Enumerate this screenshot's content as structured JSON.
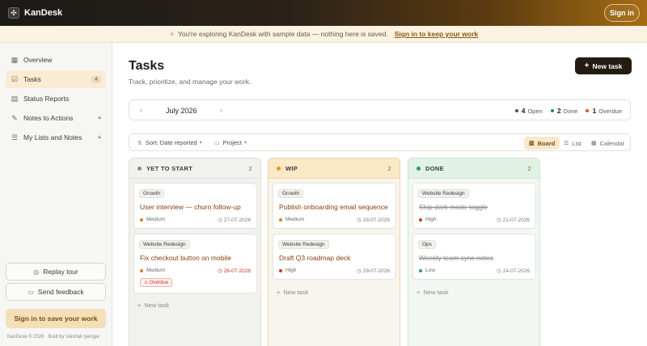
{
  "app": {
    "name": "KanDesk",
    "signin_label": "Sign in"
  },
  "banner": {
    "text": "You're exploring KanDesk with sample data — nothing here is saved.",
    "link": "Sign in to keep your work"
  },
  "sidebar": {
    "items": [
      {
        "label": "Overview",
        "icon": "grid-icon"
      },
      {
        "label": "Tasks",
        "icon": "checkbox-icon",
        "count": "4",
        "active": true
      },
      {
        "label": "Status Reports",
        "icon": "document-icon"
      },
      {
        "label": "Notes to Actions",
        "icon": "file-edit-icon",
        "locked": true
      },
      {
        "label": "My Lists and Notes",
        "icon": "list-icon",
        "locked": true
      }
    ],
    "replay_tour": "Replay tour",
    "send_feedback": "Send feedback",
    "cta": "Sign in to save your work",
    "footer": "KanDesk © 2026 · Built by Vaishali Iyengar"
  },
  "page": {
    "title": "Tasks",
    "subtitle": "Track, prioritize, and manage your work.",
    "new_task_label": "New task"
  },
  "month": {
    "label": "July 2026",
    "stats": [
      {
        "count": "4",
        "label": "Open",
        "color": "#555555"
      },
      {
        "count": "2",
        "label": "Done",
        "color": "#2e8a55"
      },
      {
        "count": "1",
        "label": "Overdue",
        "color": "#d9542c"
      }
    ]
  },
  "toolbar": {
    "sort_label": "Sort: Date reported",
    "project_label": "Project",
    "views": [
      "Board",
      "List",
      "Calendar"
    ],
    "active_view": "Board"
  },
  "columns": [
    {
      "title": "YET TO START",
      "count": "2",
      "color": "#8a8a8a",
      "cards": [
        {
          "tag": "Growth",
          "title": "User interview — churn follow-up",
          "priority": "Medium",
          "priority_color": "#d9822c",
          "due": "27-07-2026"
        },
        {
          "tag": "Website Redesign",
          "title": "Fix checkout button on mobile",
          "priority": "Medium",
          "priority_color": "#d9822c",
          "due": "26-07-2026",
          "overdue": "Overdue"
        }
      ],
      "new_task": "New task"
    },
    {
      "title": "WIP",
      "count": "2",
      "color": "#d99a2c",
      "cards": [
        {
          "tag": "Growth",
          "title": "Publish onboarding email sequence",
          "priority": "Medium",
          "priority_color": "#d9822c",
          "due": "28-07-2026"
        },
        {
          "tag": "Website Redesign",
          "title": "Draft Q3 roadmap deck",
          "priority": "High",
          "priority_color": "#d9342c",
          "due": "29-07-2026"
        }
      ],
      "new_task": "New task"
    },
    {
      "title": "DONE",
      "count": "2",
      "color": "#2e9a5a",
      "cards": [
        {
          "tag": "Website Redesign",
          "title": "Ship dark mode toggle",
          "priority": "High",
          "priority_color": "#d9342c",
          "due": "21-07-2026"
        },
        {
          "tag": "Ops",
          "title": "Weekly team sync notes",
          "priority": "Low",
          "priority_color": "#2e9a5a",
          "due": "24-07-2026"
        }
      ],
      "new_task": "New task"
    }
  ]
}
